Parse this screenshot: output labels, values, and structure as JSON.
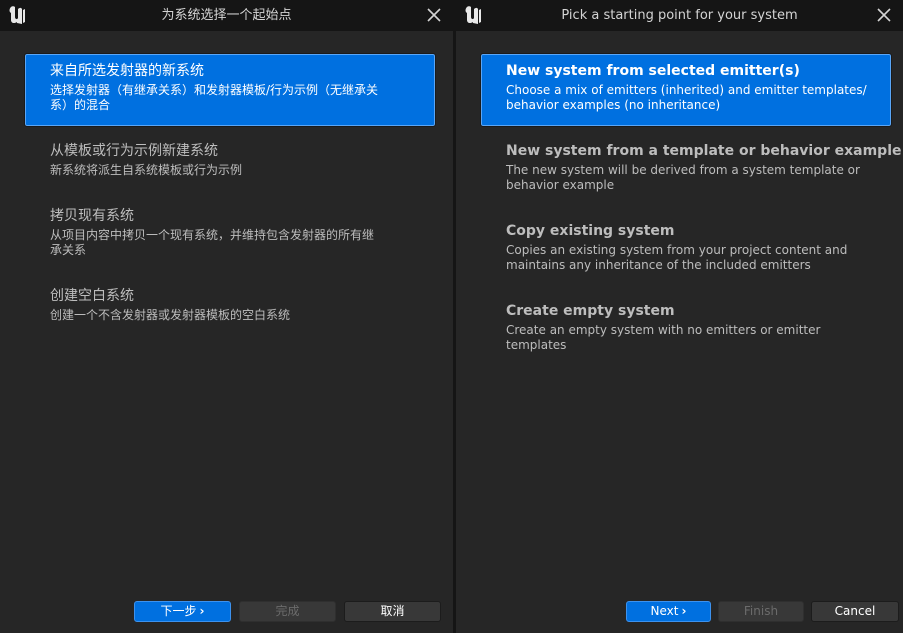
{
  "left_dialog": {
    "title": "为系统选择一个起始点",
    "options": [
      {
        "title": "来自所选发射器的新系统",
        "desc_line1": "选择发射器（有继承关系）和发射器模板/行为示例（无继承关",
        "desc_line2": "系）的混合"
      },
      {
        "title": "从模板或行为示例新建系统",
        "desc_line1": "新系统将派生自系统模板或行为示例",
        "desc_line2": ""
      },
      {
        "title": "拷贝现有系统",
        "desc_line1": "从项目内容中拷贝一个现有系统，并维持包含发射器的所有继",
        "desc_line2": "承关系"
      },
      {
        "title": "创建空白系统",
        "desc_line1": "创建一个不含发射器或发射器模板的空白系统",
        "desc_line2": ""
      }
    ],
    "buttons": {
      "next": "下一步",
      "finish": "完成",
      "cancel": "取消"
    }
  },
  "right_dialog": {
    "title": "Pick a starting point for your system",
    "options": [
      {
        "title": "New system from selected emitter(s)",
        "desc_line1": "Choose a mix of emitters (inherited) and emitter templates/",
        "desc_line2": "behavior examples (no inheritance)"
      },
      {
        "title": "New system from a template or behavior example",
        "desc_line1": "The new system will be derived from a system template or",
        "desc_line2": "behavior example"
      },
      {
        "title": "Copy existing system",
        "desc_line1": "Copies an existing system from your project content and",
        "desc_line2": "maintains any inheritance of the included emitters"
      },
      {
        "title": "Create empty system",
        "desc_line1": "Create an empty system with no emitters or emitter templates",
        "desc_line2": ""
      }
    ],
    "buttons": {
      "next": "Next",
      "finish": "Finish",
      "cancel": "Cancel"
    }
  },
  "selected_option_index": 0,
  "icons": {
    "logo": "unreal-engine-logo-icon",
    "close": "close-icon",
    "next": "chevron-right-icon"
  },
  "colors": {
    "accent": "#0070e0",
    "accent_border": "#5aa6f7",
    "panel_bg": "#262626",
    "titlebar_bg": "#151515",
    "text": "#bdbdbd",
    "disabled_text": "#6b6b6b"
  }
}
